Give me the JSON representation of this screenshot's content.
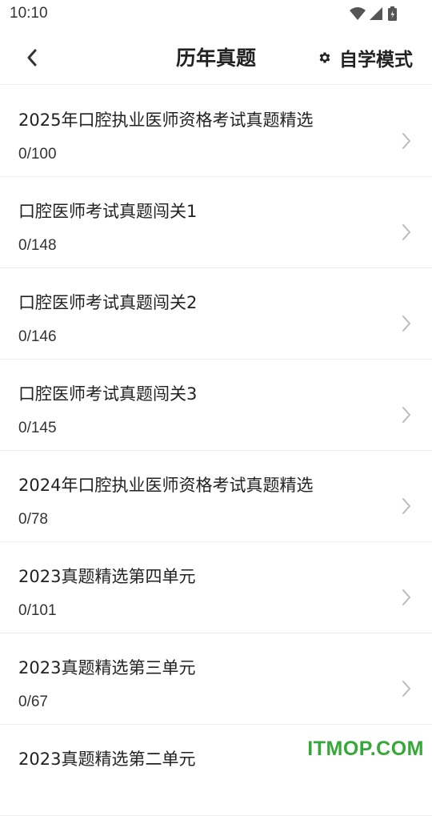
{
  "status_bar": {
    "time": "10:10",
    "icons": [
      "wifi-icon",
      "cell-signal-icon",
      "battery-charging-icon"
    ]
  },
  "header": {
    "back_icon": "chevron-left-icon",
    "title": "历年真题",
    "mode_icon": "gear-icon",
    "mode_label": "自学模式"
  },
  "list": {
    "chevron_icon": "chevron-right-icon",
    "items": [
      {
        "title": "2025年口腔执业医师资格考试真题精选",
        "progress": "0/100"
      },
      {
        "title": "口腔医师考试真题闯关1",
        "progress": "0/148"
      },
      {
        "title": "口腔医师考试真题闯关2",
        "progress": "0/146"
      },
      {
        "title": "口腔医师考试真题闯关3",
        "progress": "0/145"
      },
      {
        "title": "2024年口腔执业医师资格考试真题精选",
        "progress": "0/78"
      },
      {
        "title": "2023真题精选第四单元",
        "progress": "0/101"
      },
      {
        "title": "2023真题精选第三单元",
        "progress": "0/67"
      },
      {
        "title": "2023真题精选第二单元",
        "progress": ""
      }
    ]
  },
  "watermark": "ITMOP.COM",
  "colors": {
    "watermark": "#35a838",
    "divider": "#ececec",
    "text": "#222222",
    "chevron": "#bbbbbb"
  }
}
